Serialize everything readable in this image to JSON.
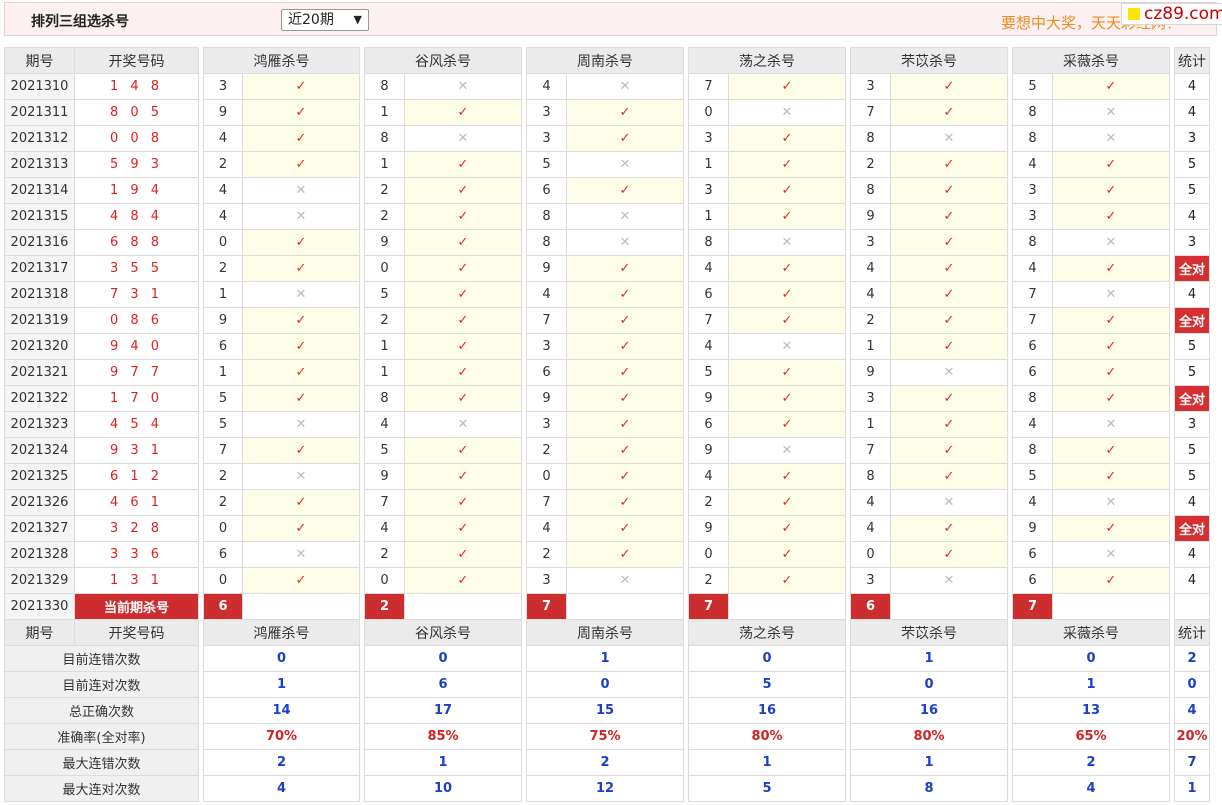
{
  "header": {
    "title": "排列三组选杀号",
    "period_select": "近20期",
    "slogan": "要想中大奖，天天彩经网！",
    "badge": "cz89.com"
  },
  "columns": {
    "issue": "期号",
    "numbers": "开奖号码",
    "experts": [
      "鸿雁杀号",
      "谷风杀号",
      "周南杀号",
      "荡之杀号",
      "芣苡杀号",
      "采薇杀号"
    ],
    "stat": "统计"
  },
  "rows": [
    {
      "issue": "2021310",
      "numbers": "1 4 8",
      "picks": [
        {
          "k": "3",
          "r": true
        },
        {
          "k": "8",
          "r": false
        },
        {
          "k": "4",
          "r": false
        },
        {
          "k": "7",
          "r": true
        },
        {
          "k": "3",
          "r": true
        },
        {
          "k": "5",
          "r": true
        }
      ],
      "stat": "4"
    },
    {
      "issue": "2021311",
      "numbers": "8 0 5",
      "picks": [
        {
          "k": "9",
          "r": true
        },
        {
          "k": "1",
          "r": true
        },
        {
          "k": "3",
          "r": true
        },
        {
          "k": "0",
          "r": false
        },
        {
          "k": "7",
          "r": true
        },
        {
          "k": "8",
          "r": false
        }
      ],
      "stat": "4"
    },
    {
      "issue": "2021312",
      "numbers": "0 0 8",
      "picks": [
        {
          "k": "4",
          "r": true
        },
        {
          "k": "8",
          "r": false
        },
        {
          "k": "3",
          "r": true
        },
        {
          "k": "3",
          "r": true
        },
        {
          "k": "8",
          "r": false
        },
        {
          "k": "8",
          "r": false
        }
      ],
      "stat": "3"
    },
    {
      "issue": "2021313",
      "numbers": "5 9 3",
      "picks": [
        {
          "k": "2",
          "r": true
        },
        {
          "k": "1",
          "r": true
        },
        {
          "k": "5",
          "r": false
        },
        {
          "k": "1",
          "r": true
        },
        {
          "k": "2",
          "r": true
        },
        {
          "k": "4",
          "r": true
        }
      ],
      "stat": "5"
    },
    {
      "issue": "2021314",
      "numbers": "1 9 4",
      "picks": [
        {
          "k": "4",
          "r": false
        },
        {
          "k": "2",
          "r": true
        },
        {
          "k": "6",
          "r": true
        },
        {
          "k": "3",
          "r": true
        },
        {
          "k": "8",
          "r": true
        },
        {
          "k": "3",
          "r": true
        }
      ],
      "stat": "5"
    },
    {
      "issue": "2021315",
      "numbers": "4 8 4",
      "picks": [
        {
          "k": "4",
          "r": false
        },
        {
          "k": "2",
          "r": true
        },
        {
          "k": "8",
          "r": false
        },
        {
          "k": "1",
          "r": true
        },
        {
          "k": "9",
          "r": true
        },
        {
          "k": "3",
          "r": true
        }
      ],
      "stat": "4"
    },
    {
      "issue": "2021316",
      "numbers": "6 8 8",
      "picks": [
        {
          "k": "0",
          "r": true
        },
        {
          "k": "9",
          "r": true
        },
        {
          "k": "8",
          "r": false
        },
        {
          "k": "8",
          "r": false
        },
        {
          "k": "3",
          "r": true
        },
        {
          "k": "8",
          "r": false
        }
      ],
      "stat": "3"
    },
    {
      "issue": "2021317",
      "numbers": "3 5 5",
      "picks": [
        {
          "k": "2",
          "r": true
        },
        {
          "k": "0",
          "r": true
        },
        {
          "k": "9",
          "r": true
        },
        {
          "k": "4",
          "r": true
        },
        {
          "k": "4",
          "r": true
        },
        {
          "k": "4",
          "r": true
        }
      ],
      "stat": "全对",
      "full": true
    },
    {
      "issue": "2021318",
      "numbers": "7 3 1",
      "picks": [
        {
          "k": "1",
          "r": false
        },
        {
          "k": "5",
          "r": true
        },
        {
          "k": "4",
          "r": true
        },
        {
          "k": "6",
          "r": true
        },
        {
          "k": "4",
          "r": true
        },
        {
          "k": "7",
          "r": false
        }
      ],
      "stat": "4"
    },
    {
      "issue": "2021319",
      "numbers": "0 8 6",
      "picks": [
        {
          "k": "9",
          "r": true
        },
        {
          "k": "2",
          "r": true
        },
        {
          "k": "7",
          "r": true
        },
        {
          "k": "7",
          "r": true
        },
        {
          "k": "2",
          "r": true
        },
        {
          "k": "7",
          "r": true
        }
      ],
      "stat": "全对",
      "full": true
    },
    {
      "issue": "2021320",
      "numbers": "9 4 0",
      "picks": [
        {
          "k": "6",
          "r": true
        },
        {
          "k": "1",
          "r": true
        },
        {
          "k": "3",
          "r": true
        },
        {
          "k": "4",
          "r": false
        },
        {
          "k": "1",
          "r": true
        },
        {
          "k": "6",
          "r": true
        }
      ],
      "stat": "5"
    },
    {
      "issue": "2021321",
      "numbers": "9 7 7",
      "picks": [
        {
          "k": "1",
          "r": true
        },
        {
          "k": "1",
          "r": true
        },
        {
          "k": "6",
          "r": true
        },
        {
          "k": "5",
          "r": true
        },
        {
          "k": "9",
          "r": false
        },
        {
          "k": "6",
          "r": true
        }
      ],
      "stat": "5"
    },
    {
      "issue": "2021322",
      "numbers": "1 7 0",
      "picks": [
        {
          "k": "5",
          "r": true
        },
        {
          "k": "8",
          "r": true
        },
        {
          "k": "9",
          "r": true
        },
        {
          "k": "9",
          "r": true
        },
        {
          "k": "3",
          "r": true
        },
        {
          "k": "8",
          "r": true
        }
      ],
      "stat": "全对",
      "full": true
    },
    {
      "issue": "2021323",
      "numbers": "4 5 4",
      "picks": [
        {
          "k": "5",
          "r": false
        },
        {
          "k": "4",
          "r": false
        },
        {
          "k": "3",
          "r": true
        },
        {
          "k": "6",
          "r": true
        },
        {
          "k": "1",
          "r": true
        },
        {
          "k": "4",
          "r": false
        }
      ],
      "stat": "3"
    },
    {
      "issue": "2021324",
      "numbers": "9 3 1",
      "picks": [
        {
          "k": "7",
          "r": true
        },
        {
          "k": "5",
          "r": true
        },
        {
          "k": "2",
          "r": true
        },
        {
          "k": "9",
          "r": false
        },
        {
          "k": "7",
          "r": true
        },
        {
          "k": "8",
          "r": true
        }
      ],
      "stat": "5"
    },
    {
      "issue": "2021325",
      "numbers": "6 1 2",
      "picks": [
        {
          "k": "2",
          "r": false
        },
        {
          "k": "9",
          "r": true
        },
        {
          "k": "0",
          "r": true
        },
        {
          "k": "4",
          "r": true
        },
        {
          "k": "8",
          "r": true
        },
        {
          "k": "5",
          "r": true
        }
      ],
      "stat": "5"
    },
    {
      "issue": "2021326",
      "numbers": "4 6 1",
      "picks": [
        {
          "k": "2",
          "r": true
        },
        {
          "k": "7",
          "r": true
        },
        {
          "k": "7",
          "r": true
        },
        {
          "k": "2",
          "r": true
        },
        {
          "k": "4",
          "r": false
        },
        {
          "k": "4",
          "r": false
        }
      ],
      "stat": "4"
    },
    {
      "issue": "2021327",
      "numbers": "3 2 8",
      "picks": [
        {
          "k": "0",
          "r": true
        },
        {
          "k": "4",
          "r": true
        },
        {
          "k": "4",
          "r": true
        },
        {
          "k": "9",
          "r": true
        },
        {
          "k": "4",
          "r": true
        },
        {
          "k": "9",
          "r": true
        }
      ],
      "stat": "全对",
      "full": true
    },
    {
      "issue": "2021328",
      "numbers": "3 3 6",
      "picks": [
        {
          "k": "6",
          "r": false
        },
        {
          "k": "2",
          "r": true
        },
        {
          "k": "2",
          "r": true
        },
        {
          "k": "0",
          "r": true
        },
        {
          "k": "0",
          "r": true
        },
        {
          "k": "6",
          "r": false
        }
      ],
      "stat": "4"
    },
    {
      "issue": "2021329",
      "numbers": "1 3 1",
      "picks": [
        {
          "k": "0",
          "r": true
        },
        {
          "k": "0",
          "r": true
        },
        {
          "k": "3",
          "r": false
        },
        {
          "k": "2",
          "r": true
        },
        {
          "k": "3",
          "r": false
        },
        {
          "k": "6",
          "r": true
        }
      ],
      "stat": "4"
    }
  ],
  "current": {
    "issue": "2021330",
    "label": "当前期杀号",
    "kills": [
      "6",
      "2",
      "7",
      "7",
      "6",
      "7"
    ]
  },
  "summary": [
    {
      "label": "目前连错次数",
      "values": [
        "0",
        "0",
        "1",
        "0",
        "1",
        "0"
      ],
      "stat": "2"
    },
    {
      "label": "目前连对次数",
      "values": [
        "1",
        "6",
        "0",
        "5",
        "0",
        "1"
      ],
      "stat": "0"
    },
    {
      "label": "总正确次数",
      "values": [
        "14",
        "17",
        "15",
        "16",
        "16",
        "13"
      ],
      "stat": "4"
    },
    {
      "label": "准确率(全对率)",
      "values": [
        "70%",
        "85%",
        "75%",
        "80%",
        "80%",
        "65%"
      ],
      "stat": "20%",
      "rate": true
    },
    {
      "label": "最大连错次数",
      "values": [
        "2",
        "1",
        "2",
        "1",
        "1",
        "2"
      ],
      "stat": "7"
    },
    {
      "label": "最大连对次数",
      "values": [
        "4",
        "10",
        "12",
        "5",
        "8",
        "4"
      ],
      "stat": "1"
    }
  ],
  "glyphs": {
    "hit": "✓",
    "miss": "✕"
  },
  "colors": {
    "hit": "#e8262a",
    "miss": "#bbbbbb",
    "accent": "#cc2e2f",
    "summary_value": "#1a3fc7"
  }
}
